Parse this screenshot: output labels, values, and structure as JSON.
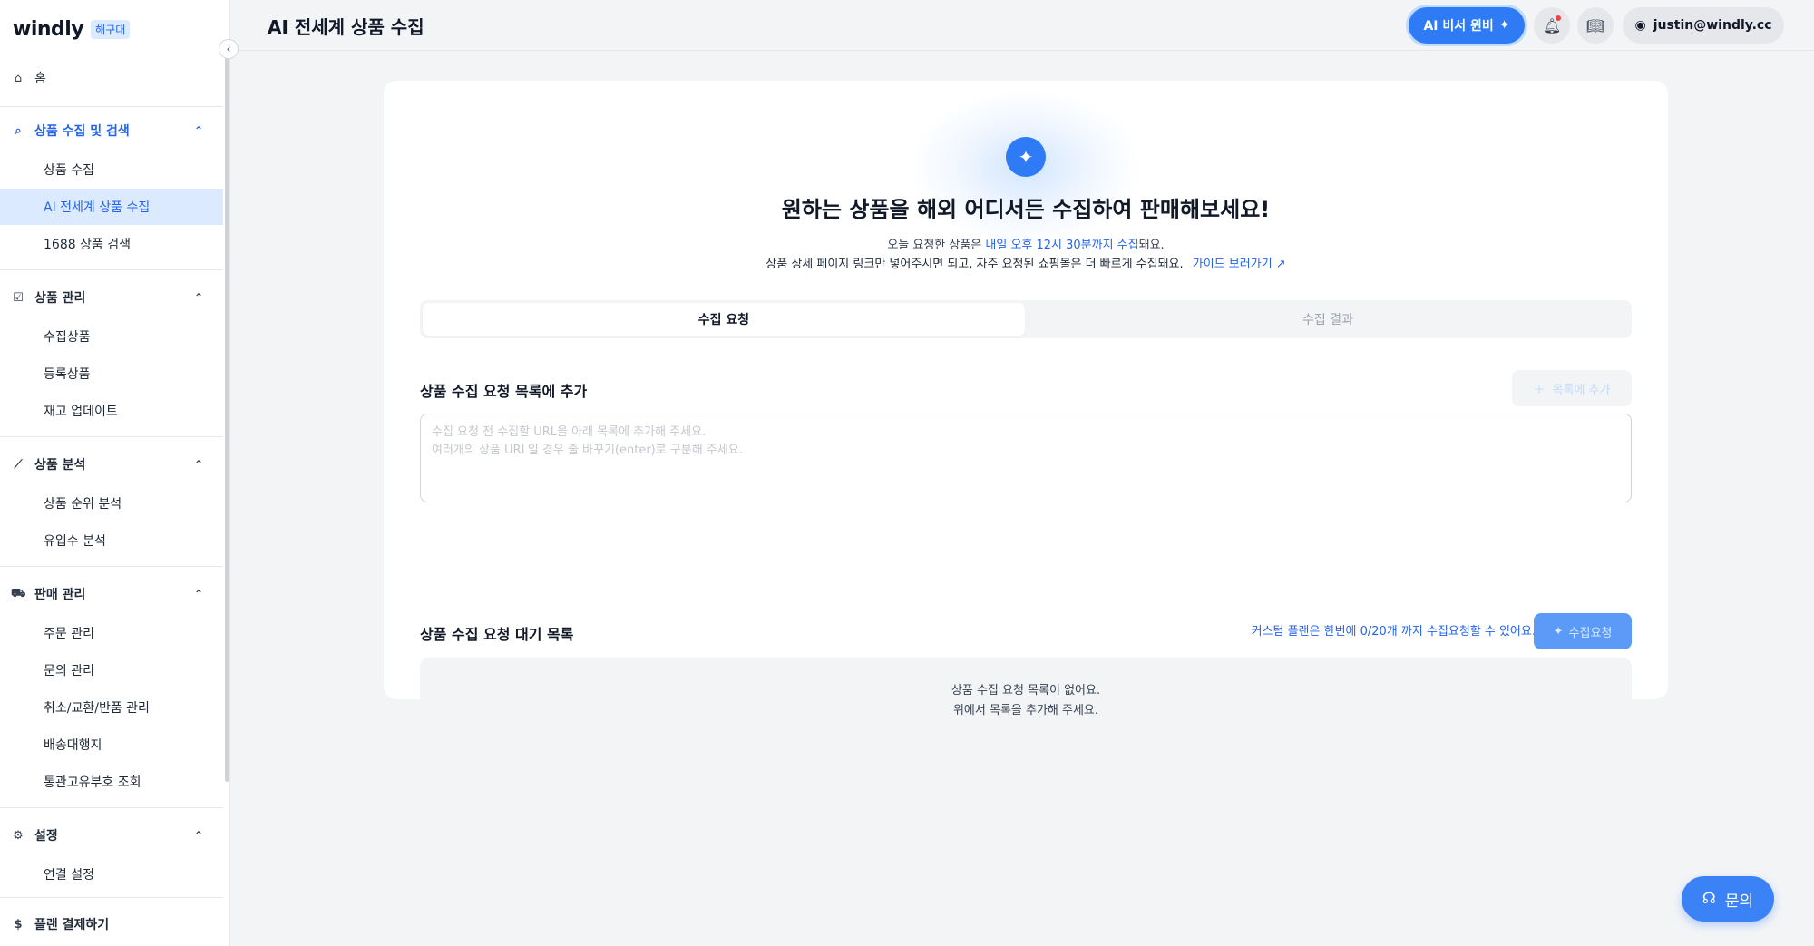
{
  "brand": {
    "logo": "windly",
    "badge": "해구대"
  },
  "sidebar": {
    "home": "홈",
    "sections": [
      {
        "label": "상품 수집 및 검색",
        "items": [
          "상품 수집",
          "AI 전세계 상품 수집",
          "1688 상품 검색"
        ]
      },
      {
        "label": "상품 관리",
        "items": [
          "수집상품",
          "등록상품",
          "재고 업데이트"
        ]
      },
      {
        "label": "상품 분석",
        "items": [
          "상품 순위 분석",
          "유입수 분석"
        ]
      },
      {
        "label": "판매 관리",
        "items": [
          "주문 관리",
          "문의 관리",
          "취소/교환/반품 관리",
          "배송대행지",
          "통관고유부호 조회"
        ]
      },
      {
        "label": "설정",
        "items": [
          "연결 설정"
        ]
      }
    ],
    "plan_payment": "플랜 결제하기",
    "selected_item": "AI 전세계 상품 수집"
  },
  "header": {
    "title": "AI 전세계 상품 수집",
    "ai_button": "AI 비서 윈비",
    "user_email": "justin@windly.cc"
  },
  "main": {
    "hero_title": "원하는 상품을 해외 어디서든 수집하여 판매해보세요!",
    "sub1_prefix": "오늘 요청한 상품은 ",
    "sub1_highlight": "내일 오후 12시 30분까지 수집",
    "sub1_suffix": "돼요.",
    "sub2": "상품 상세 페이지 링크만 넣어주시면 되고, 자주 요청된 쇼핑몰은 더 빠르게 수집돼요.",
    "guide_link": "가이드 보러가기",
    "tabs": [
      {
        "label": "수집 요청",
        "active": true
      },
      {
        "label": "수집 결과",
        "active": false
      }
    ],
    "add_section_title": "상품 수집 요청 목록에 추가",
    "add_button": "목록에 추가",
    "url_placeholder": "수집 요청 전 수집할 URL을 아래 목록에 추가해 주세요.\n여러개의 상품 URL일 경우 줄 바꾸기(enter)로 구분해 주세요.",
    "queue_section_title": "상품 수집 요청 대기 목록",
    "plan_note": "커스텀 플랜은 한번에 0/20개 까지 수집요청할 수 있어요.",
    "collect_button": "수집요청",
    "empty_line1": "상품 수집 요청 목록이 없어요.",
    "empty_line2": "위에서 목록을 추가해 주세요."
  },
  "inquiry_button": "문의",
  "colors": {
    "accent": "#2f7bf5",
    "selected_bg": "#dbeafe",
    "page_bg": "#f3f4f6"
  }
}
